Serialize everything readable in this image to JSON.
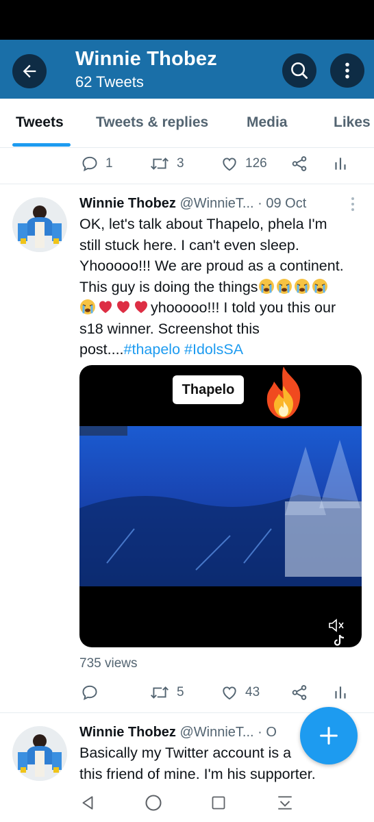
{
  "header": {
    "title": "Winnie Thobez",
    "subtitle": "62 Tweets",
    "bg_color": "#1a6fa8"
  },
  "tabs": [
    {
      "label": "Tweets",
      "active": true
    },
    {
      "label": "Tweets & replies",
      "active": false
    },
    {
      "label": "Media",
      "active": false
    },
    {
      "label": "Likes",
      "active": false
    }
  ],
  "prev_tweet_actions": {
    "replies": "1",
    "retweets": "3",
    "likes": "126"
  },
  "tweet1": {
    "name": "Winnie Thobez",
    "handle": "@WinnieT...",
    "sep": " · ",
    "date": "09 Oct",
    "line1": "OK, let's talk about Thapelo, phela I'm",
    "line2": "still stuck here. I can't even sleep.",
    "line3": "Yhooooo!!! We are proud as a continent.",
    "line4": "This guy is doing the things",
    "line5": "yhooooo!!! I told you this our",
    "line6": "s18 winner. Screenshot this",
    "line7": "post....",
    "hashtags": "#thapelo #IdolsSA",
    "video_tag": "Thapelo",
    "views": "735 views",
    "replies": "",
    "retweets": "5",
    "likes": "43"
  },
  "tweet2": {
    "name": "Winnie Thobez",
    "handle": "@WinnieT...",
    "sep": " · O",
    "line1": "Basically my Twitter account is a",
    "line2": "this friend of mine. I'm his supporter."
  },
  "icons": {
    "back": "arrow-left-icon",
    "search": "search-icon",
    "more": "more-vertical-icon",
    "reply": "reply-icon",
    "retweet": "retweet-icon",
    "like": "heart-icon",
    "share": "share-icon",
    "analytics": "analytics-icon",
    "compose": "plus-icon"
  },
  "colors": {
    "accent": "#1d9bf0",
    "header_dark": "#0e2c45"
  }
}
